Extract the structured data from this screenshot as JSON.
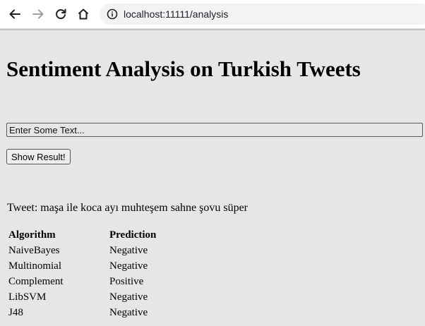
{
  "browser": {
    "url": "localhost:11111/analysis"
  },
  "page": {
    "title": "Sentiment Analysis on Turkish Tweets",
    "input_placeholder": "Enter Some Text...",
    "button_label": "Show Result!",
    "tweet_line": "Tweet: maşa ile koca ayı muhteşem sahne şovu süper"
  },
  "table": {
    "headers": [
      "Algorithm",
      "Prediction"
    ],
    "rows": [
      [
        "NaiveBayes",
        "Negative"
      ],
      [
        "Multinomial",
        "Negative"
      ],
      [
        "Complement",
        "Positive"
      ],
      [
        "LibSVM",
        "Negative"
      ],
      [
        "J48",
        "Negative"
      ]
    ]
  }
}
